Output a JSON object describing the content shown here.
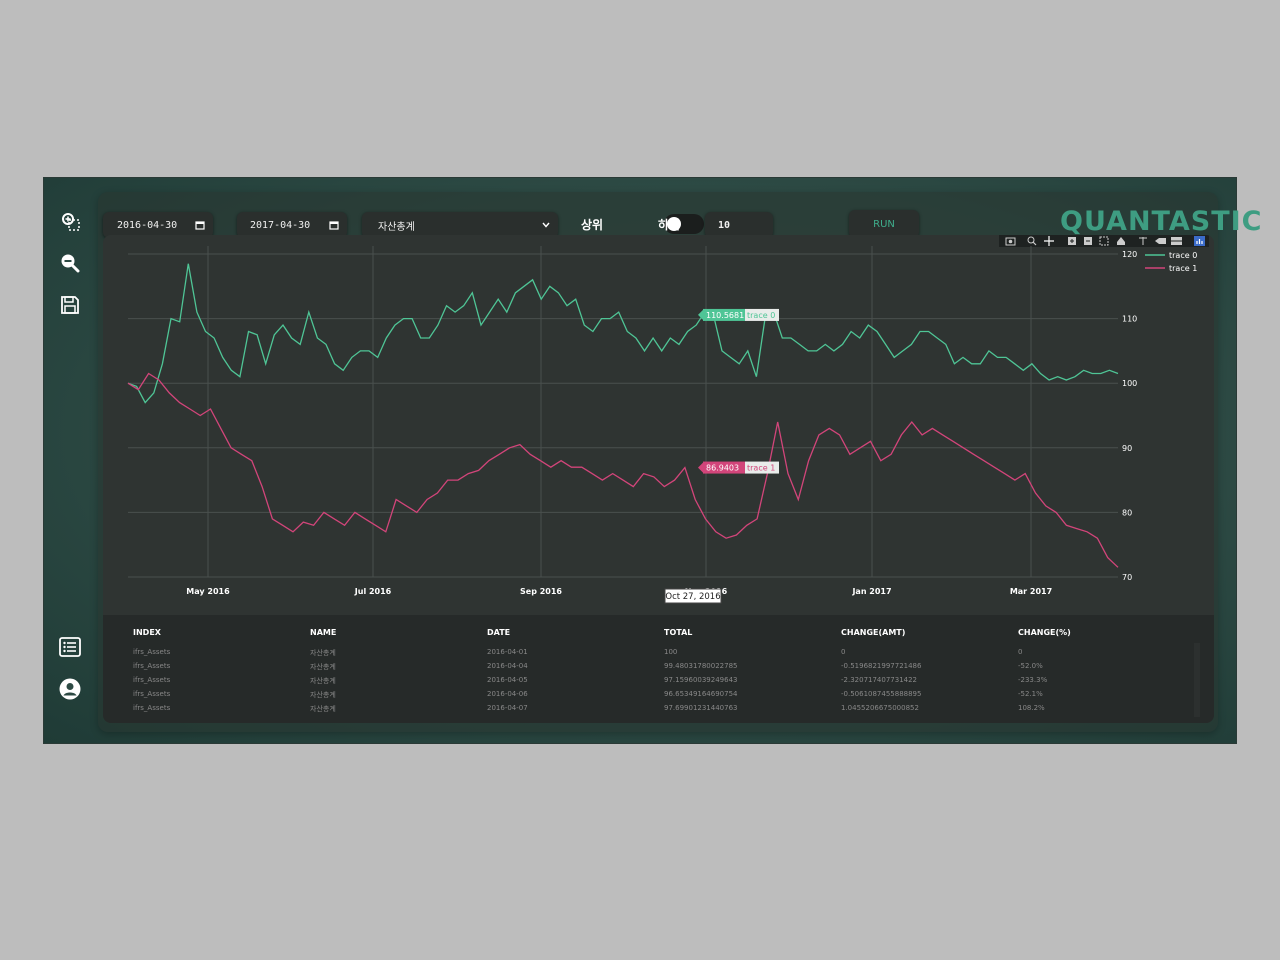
{
  "sidebar": {
    "icons": [
      "zoom-select-icon",
      "zoom-out-icon",
      "save-icon",
      "list-icon",
      "user-icon"
    ]
  },
  "controls": {
    "start_date": "2016-04-30",
    "end_date": "2017-04-30",
    "tilde": "~",
    "account_select": "자산총계",
    "toggle_left_label": "상위",
    "toggle_right_label": "하위",
    "count_value": "10",
    "run_label": "RUN"
  },
  "logo": "QUANTASTIC",
  "colors": {
    "accent": "#3fae8c",
    "trace0": "#4fc596",
    "trace1": "#d2457a",
    "background": "#2d4a44"
  },
  "chart_data": {
    "type": "line",
    "x_ticks": [
      "May 2016",
      "Jul 2016",
      "Sep 2016",
      "Nov 2016",
      "Jan 2017",
      "Mar 2017"
    ],
    "ylim": [
      70,
      120
    ],
    "y_ticks": [
      "70",
      "80",
      "90",
      "100",
      "110",
      "120"
    ],
    "grid": true,
    "legend_position": "top-right",
    "series": [
      {
        "name": "trace 0",
        "values": [
          100,
          99.5,
          97,
          98.5,
          103,
          110,
          109.5,
          118.5,
          111,
          108,
          107,
          104,
          102,
          101,
          108,
          107.5,
          103,
          107.5,
          109,
          107,
          106,
          111,
          107,
          106,
          103,
          102,
          104,
          105,
          105,
          104,
          107,
          109,
          110,
          110,
          107,
          107,
          109,
          112,
          111,
          112,
          114,
          109,
          111,
          113,
          111,
          114,
          115,
          116,
          113,
          115,
          114,
          112,
          113,
          109,
          108,
          110,
          110,
          111,
          108,
          107,
          105,
          107,
          105,
          107,
          106,
          108,
          109,
          111,
          110.5681,
          105,
          104,
          103,
          105,
          101,
          110,
          111,
          107,
          107,
          106,
          105,
          105,
          106,
          105,
          106,
          108,
          107,
          109,
          108,
          106,
          104,
          105,
          106,
          108,
          108,
          107,
          106,
          103,
          104,
          103,
          103,
          105,
          104,
          104,
          103,
          102,
          103,
          101.5,
          100.5,
          101,
          100.5,
          101,
          102,
          101.5,
          101.5,
          102,
          101.5
        ]
      },
      {
        "name": "trace 1",
        "values": [
          100,
          99,
          101.5,
          100.5,
          98.5,
          97,
          96,
          95,
          96,
          93,
          90,
          89,
          88,
          84,
          79,
          78,
          77,
          78.5,
          78,
          80,
          79,
          78,
          80,
          79,
          78,
          77,
          82,
          81,
          80,
          82,
          83,
          85,
          85,
          86,
          86.5,
          88,
          89,
          90,
          90.5,
          89,
          88,
          87,
          88,
          87,
          87,
          86,
          85,
          86,
          85,
          84,
          86,
          85.5,
          84,
          85,
          86.9403,
          82,
          79,
          77,
          76,
          76.5,
          78,
          79,
          86,
          94,
          86,
          82,
          88,
          92,
          93,
          92,
          89,
          90,
          91,
          88,
          89,
          92,
          94,
          92,
          93,
          92,
          91,
          90,
          89,
          88,
          87,
          86,
          85,
          86,
          83,
          81,
          80,
          78,
          77.5,
          77,
          76,
          73,
          71.5
        ]
      }
    ],
    "hover": {
      "x_label": "Oct 27, 2016",
      "trace0_value": "110.5681",
      "trace1_value": "86.9403"
    }
  },
  "table": {
    "columns": [
      "INDEX",
      "NAME",
      "DATE",
      "TOTAL",
      "CHANGE(AMT)",
      "CHANGE(%)"
    ],
    "rows": [
      [
        "ifrs_Assets",
        "자산총계",
        "2016-04-01",
        "100",
        "0",
        "0"
      ],
      [
        "ifrs_Assets",
        "자산총계",
        "2016-04-04",
        "99.48031780022785",
        "-0.5196821997721486",
        "-52.0%"
      ],
      [
        "ifrs_Assets",
        "자산총계",
        "2016-04-05",
        "97.15960039249643",
        "-2.320717407731422",
        "-233.3%"
      ],
      [
        "ifrs_Assets",
        "자산총계",
        "2016-04-06",
        "96.65349164690754",
        "-0.5061087455888895",
        "-52.1%"
      ],
      [
        "ifrs_Assets",
        "자산총계",
        "2016-04-07",
        "97.69901231440763",
        "1.0455206675000852",
        "108.2%"
      ]
    ]
  }
}
